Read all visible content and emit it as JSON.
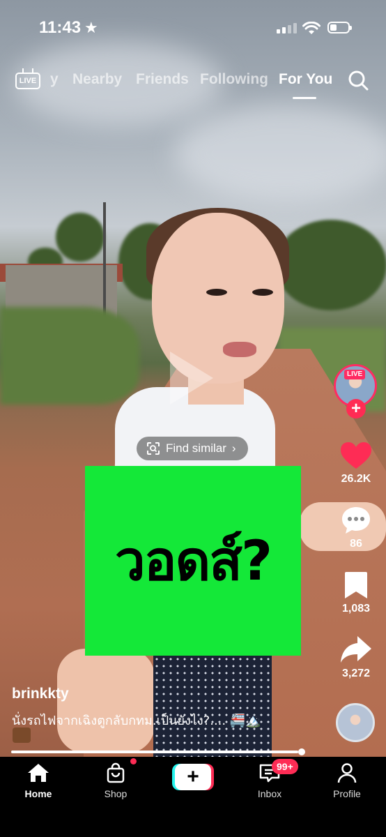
{
  "status_bar": {
    "time": "11:43",
    "star": "★"
  },
  "top_nav": {
    "live_label": "LIVE",
    "tabs": [
      {
        "label": "y",
        "active": false
      },
      {
        "label": "Nearby",
        "active": false
      },
      {
        "label": "Friends",
        "active": false
      },
      {
        "label": "Following",
        "active": false
      },
      {
        "label": "For You",
        "active": true
      }
    ]
  },
  "video": {
    "find_similar": "Find similar",
    "overlay_text": "วอดส์?",
    "overlay_color": "#14e838",
    "progress_fraction": 0.98
  },
  "side_rail": {
    "live_badge": "LIVE",
    "like_count": "26.2K",
    "comment_count": "86",
    "save_count": "1,083",
    "share_count": "3,272",
    "like_color": "#fe2c55"
  },
  "post": {
    "username": "brinkkty",
    "caption": "นั่งรถไฟจากเฉิงตูกลับกทม.เป็นยังไง?.... 🚝🏔️"
  },
  "bottom_nav": {
    "items": [
      {
        "label": "Home",
        "icon": "home-icon",
        "active": true
      },
      {
        "label": "Shop",
        "icon": "shop-bag-icon",
        "active": false
      },
      {
        "label": "Inbox",
        "icon": "inbox-icon",
        "active": false
      },
      {
        "label": "Profile",
        "icon": "profile-icon",
        "active": false
      }
    ],
    "inbox_badge": "99+",
    "create_label": "+"
  }
}
